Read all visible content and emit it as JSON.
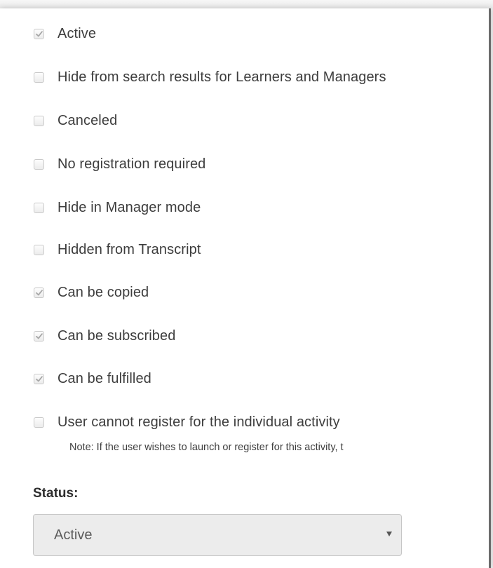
{
  "options": [
    {
      "label": "Active",
      "checked": true
    },
    {
      "label": "Hide from search results for Learners and Managers",
      "checked": false
    },
    {
      "label": "Canceled",
      "checked": false
    },
    {
      "label": "No registration required",
      "checked": false
    },
    {
      "label": "Hide in Manager mode",
      "checked": false
    },
    {
      "label": "Hidden from Transcript",
      "checked": false
    },
    {
      "label": "Can be copied",
      "checked": true
    },
    {
      "label": "Can be subscribed",
      "checked": true
    },
    {
      "label": "Can be fulfilled",
      "checked": true
    },
    {
      "label": "User cannot register for the individual activity",
      "checked": false
    }
  ],
  "note": "Note: If the user wishes to launch or register for this activity, t",
  "status": {
    "label": "Status:",
    "selected": "Active"
  },
  "colors": {
    "checkmark": "#a8a8a8",
    "text": "#3d3d3d"
  }
}
